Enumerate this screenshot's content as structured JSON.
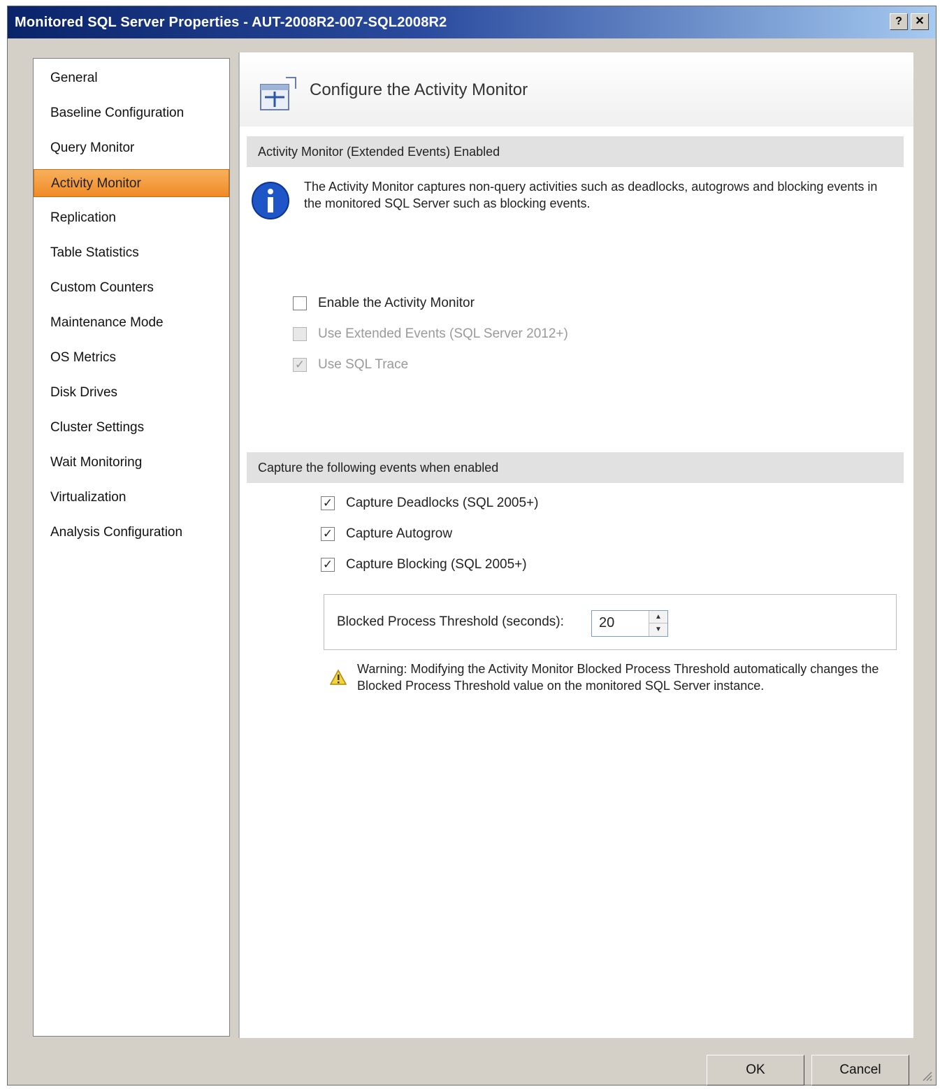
{
  "window": {
    "title": "Monitored SQL Server Properties - AUT-2008R2-007-SQL2008R2",
    "help_glyph": "?",
    "close_glyph": "✕"
  },
  "sidebar": {
    "items": [
      {
        "label": "General"
      },
      {
        "label": "Baseline Configuration"
      },
      {
        "label": "Query Monitor"
      },
      {
        "label": "Activity Monitor",
        "selected": true
      },
      {
        "label": "Replication"
      },
      {
        "label": "Table Statistics"
      },
      {
        "label": "Custom Counters"
      },
      {
        "label": "Maintenance Mode"
      },
      {
        "label": "OS Metrics"
      },
      {
        "label": "Disk Drives"
      },
      {
        "label": "Cluster Settings"
      },
      {
        "label": "Wait Monitoring"
      },
      {
        "label": "Virtualization"
      },
      {
        "label": "Analysis Configuration"
      }
    ]
  },
  "main": {
    "title": "Configure the Activity Monitor",
    "icon": "activity-monitor-icon",
    "section1": {
      "header": "Activity Monitor (Extended Events) Enabled",
      "info_text": "The Activity Monitor captures non-query activities such as deadlocks, autogrows and blocking events in the monitored SQL Server such as blocking events.",
      "options": [
        {
          "label": "Enable the Activity Monitor",
          "checked": false,
          "disabled": false
        },
        {
          "label": "Use Extended Events (SQL Server 2012+)",
          "checked": false,
          "disabled": true
        },
        {
          "label": "Use SQL Trace",
          "checked": true,
          "disabled": true
        }
      ]
    },
    "section2": {
      "header": "Capture the following events when enabled",
      "options": [
        {
          "label": "Capture Deadlocks (SQL 2005+)",
          "checked": true
        },
        {
          "label": "Capture Autogrow",
          "checked": true
        },
        {
          "label": "Capture Blocking (SQL 2005+)",
          "checked": true
        }
      ],
      "threshold_label": "Blocked Process Threshold (seconds):",
      "threshold_value": "20",
      "warning_text": "Warning: Modifying the Activity Monitor Blocked Process Threshold automatically changes the Blocked Process Threshold value on the monitored SQL Server instance."
    }
  },
  "buttons": {
    "ok": "OK",
    "cancel": "Cancel"
  },
  "colors": {
    "selected_nav": "#f08a26",
    "title_bar": "#0a246a"
  }
}
